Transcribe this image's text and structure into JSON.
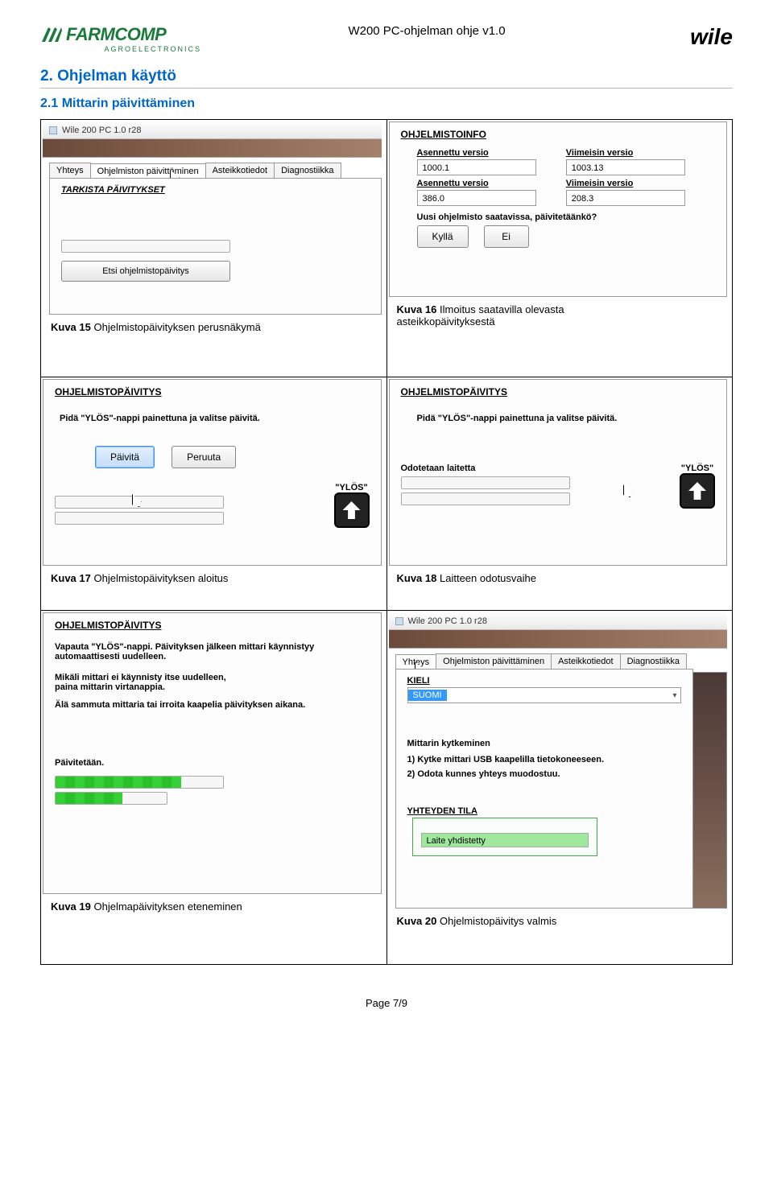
{
  "header": {
    "doc_title": "W200 PC-ohjelman ohje v1.0",
    "logo_left_top": "FARMCOMP",
    "logo_left_sub": "AGROELECTRONICS",
    "logo_right": "wile"
  },
  "section": {
    "h1": "2. Ohjelman käyttö",
    "h2": "2.1 Mittarin päivittäminen"
  },
  "captions": {
    "k15": "Ohjelmistopäivityksen perusnäkymä",
    "k16a": "Ilmoitus saatavilla olevasta",
    "k16b": "asteikkopäivityksestä",
    "k17": "Ohjelmistopäivityksen aloitus",
    "k18": "Laitteen odotusvaihe",
    "k19": "Ohjelmapäivityksen eteneminen",
    "k20": "Ohjelmistopäivitys valmis",
    "kw15": "Kuva 15",
    "kw16": "Kuva 16",
    "kw17": "Kuva 17",
    "kw18": "Kuva 18",
    "kw19": "Kuva 19",
    "kw20": "Kuva 20"
  },
  "app": {
    "window_title": "Wile 200 PC 1.0 r28",
    "tabs": {
      "yhteys": "Yhteys",
      "paivitys": "Ohjelmiston päivittäminen",
      "asteikko": "Asteikkotiedot",
      "diag": "Diagnostiikka"
    },
    "tarkista": "TARKISTA PÄIVITYKSET",
    "etsi_btn": "Etsi ohjelmistopäivitys"
  },
  "info": {
    "panel": "OHJELMISTOINFO",
    "asennettu": "Asennettu versio",
    "viimeisin": "Viimeisin versio",
    "v1a": "1000.1",
    "v1b": "1003.13",
    "v2a": "386.0",
    "v2b": "208.3",
    "q": "Uusi ohjelmisto saatavissa, päivitetäänkö?",
    "yes": "Kyllä",
    "no": "Ei"
  },
  "upd": {
    "panel": "OHJELMISTOPÄIVITYS",
    "msg": "Pidä \"YLÖS\"-nappi painettuna ja valitse päivitä.",
    "paivita": "Päivitä",
    "peruuta": "Peruuta",
    "ylos": "\"YLÖS\"",
    "odotetaan": "Odotetaan laitetta"
  },
  "done": {
    "l1": "Vapauta \"YLÖS\"-nappi. Päivityksen jälkeen mittari käynnistyy automaattisesti uudelleen.",
    "l2a": "Mikäli mittari ei käynnisty itse uudelleen,",
    "l2b": "paina mittarin virtanappia.",
    "l3": "Älä sammuta mittaria tai irroita kaapelia päivityksen aikana.",
    "paiv": "Päivitetään."
  },
  "conn": {
    "kieli": "KIELI",
    "suomi": "SUOMI",
    "kytk_title": "Mittarin kytkeminen",
    "step1": "1) Kytke mittari USB kaapelilla tietokoneeseen.",
    "step2": "2) Odota kunnes yhteys muodostuu.",
    "tila_label": "YHTEYDEN TILA",
    "tila_val": "Laite yhdistetty"
  },
  "footer": "Page 7/9"
}
